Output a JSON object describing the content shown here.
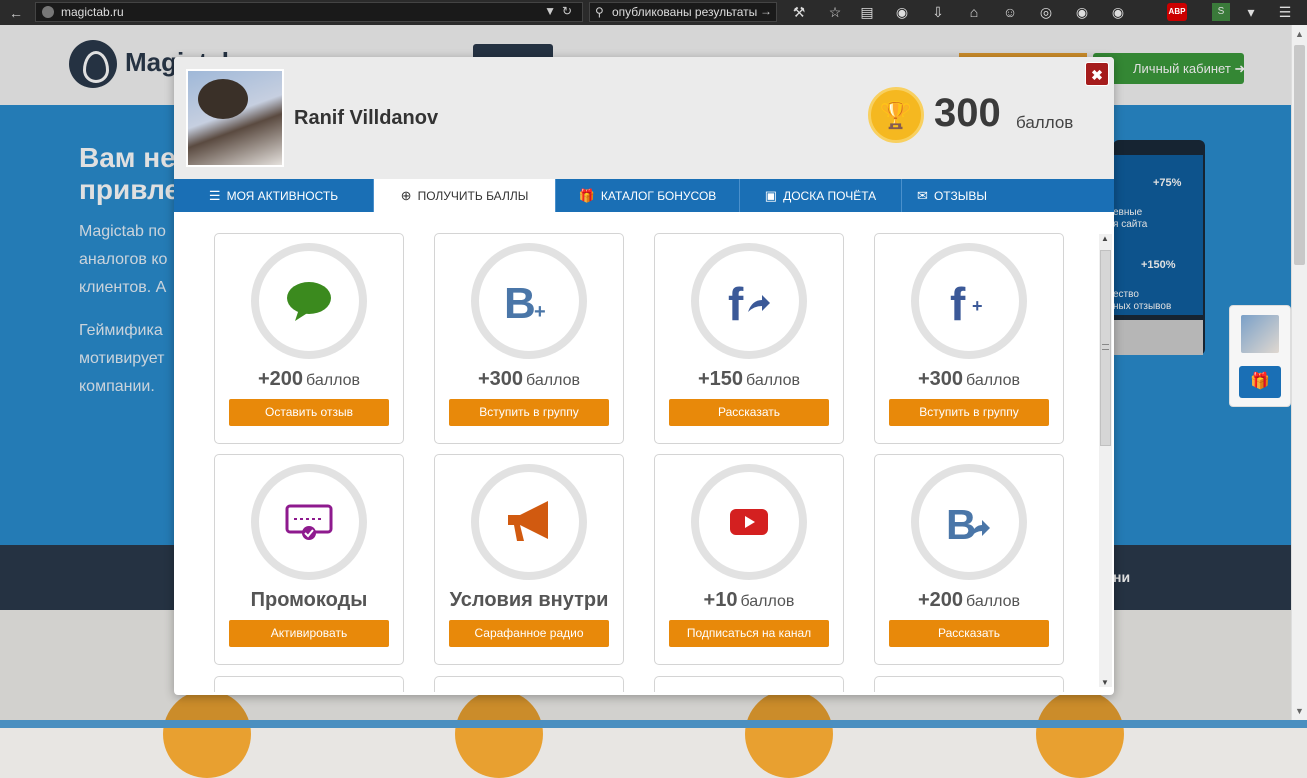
{
  "browser": {
    "url": "magictab.ru",
    "search_text": "опубликованы результаты"
  },
  "site": {
    "logo_text": "Magictab",
    "cabinet_label": "Личный кабинет",
    "hero_title_line1": "Вам не",
    "hero_title_line2": "привле",
    "hero_p1_line1": "Magictab по",
    "hero_p1_line2": "аналогов ко",
    "hero_p1_line3": "клиентов. А",
    "hero_p2_line1": "Геймифика",
    "hero_p2_line2": "мотивирует",
    "hero_p2_line3": "компании.",
    "monitor_stat1": "+75%",
    "monitor_text1": "евные",
    "monitor_text2": "я сайта",
    "monitor_stat2": "+150%",
    "monitor_text3": "ество",
    "monitor_text4": "ных отзывов",
    "band_text": "ни"
  },
  "modal": {
    "user_name": "Ranif Villdanov",
    "points": "300",
    "points_label": "баллов",
    "tabs": [
      {
        "label": "МОЯ АКТИВНОСТЬ",
        "icon": "list-icon"
      },
      {
        "label": "ПОЛУЧИТЬ БАЛЛЫ",
        "icon": "plus-circle-icon"
      },
      {
        "label": "КАТАЛОГ БОНУСОВ",
        "icon": "gift-icon"
      },
      {
        "label": "ДОСКА ПОЧЁТА",
        "icon": "portrait-icon"
      },
      {
        "label": "ОТЗЫВЫ",
        "icon": "comment-icon"
      }
    ],
    "cards": [
      {
        "icon": "chat-bubble-icon",
        "amount": "+200",
        "unit": "баллов",
        "button": "Оставить отзыв",
        "color": "#3b8a1e"
      },
      {
        "icon": "vk-plus-icon",
        "amount": "+300",
        "unit": "баллов",
        "button": "Вступить в группу",
        "color": "#4a76a8"
      },
      {
        "icon": "facebook-share-icon",
        "amount": "+150",
        "unit": "баллов",
        "button": "Рассказать",
        "color": "#3b5998"
      },
      {
        "icon": "facebook-plus-icon",
        "amount": "+300",
        "unit": "баллов",
        "button": "Вступить в группу",
        "color": "#3b5998"
      },
      {
        "icon": "promo-ticket-icon",
        "amount": "Промокоды",
        "unit": "",
        "button": "Активировать",
        "color": "#8e1a8e"
      },
      {
        "icon": "megaphone-icon",
        "amount": "Условия внутри",
        "unit": "",
        "button": "Сарафанное радио",
        "color": "#d15a10"
      },
      {
        "icon": "youtube-icon",
        "amount": "+10",
        "unit": "баллов",
        "button": "Подписаться на канал",
        "color": "#d42020"
      },
      {
        "icon": "vk-share-icon",
        "amount": "+200",
        "unit": "баллов",
        "button": "Рассказать",
        "color": "#4a76a8"
      }
    ]
  }
}
